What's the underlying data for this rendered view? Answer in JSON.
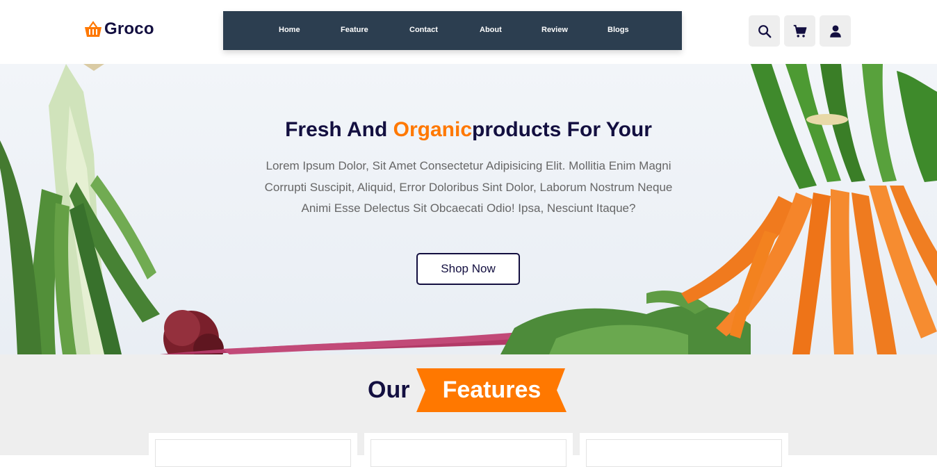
{
  "brand": {
    "name": "Groco",
    "logo_icon": "basket-icon",
    "accent": "#ff7800",
    "dark": "#130f40"
  },
  "nav": {
    "items": [
      {
        "label": "Home"
      },
      {
        "label": "Feature"
      },
      {
        "label": "Contact"
      },
      {
        "label": "About"
      },
      {
        "label": "Review"
      },
      {
        "label": "Blogs"
      }
    ],
    "background": "#2c3e50"
  },
  "header_icons": [
    "search-icon",
    "cart-icon",
    "user-icon"
  ],
  "hero": {
    "title_part1": "Fresh And ",
    "title_accent": "Organic",
    "title_part2": "products For Your",
    "text": "Lorem Ipsum Dolor, Sit Amet Consectetur Adipisicing Elit. Mollitia Enim Magni Corrupti Suscipit, Aliquid, Error Doloribus Sint Dolor, Laborum Nostrum Neque Animi Esse Delectus Sit Obcaecati Odio! Ipsa, Nesciunt Itaque?",
    "button": "Shop Now"
  },
  "features": {
    "heading_plain": "Our",
    "heading_ribbon": "Features"
  }
}
